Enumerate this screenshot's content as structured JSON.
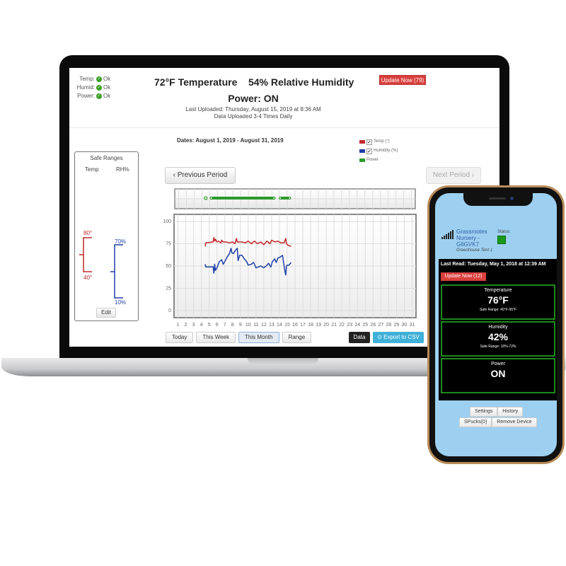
{
  "desktop": {
    "status": [
      {
        "label": "Temp:",
        "value": "Ok"
      },
      {
        "label": "Humid:",
        "value": "Ok"
      },
      {
        "label": "Power:",
        "value": "Ok"
      }
    ],
    "headline": "72°F Temperature    54% Relative Humidity",
    "power": "Power: ON",
    "last_uploaded": "Last Uploaded: Thursday, August 15, 2019 at 8:36 AM",
    "upload_frequency": "Data Uploaded 3-4 Times Daily",
    "update_button": "Update Now (79)",
    "dates": "Dates: August 1, 2019 - August 31, 2019",
    "legend": [
      {
        "label": "Temp (°)",
        "color": "#c0282d",
        "checked": true
      },
      {
        "label": "Humidity (%)",
        "color": "#1f3fa8",
        "checked": true
      },
      {
        "label": "Power",
        "color": "#2d9a2d",
        "checked": null
      }
    ],
    "prev_button": "Previous Period",
    "next_button": "Next Period",
    "safe_ranges": {
      "title": "Safe Ranges",
      "temp_label": "Temp",
      "rh_label": "RH%",
      "temp_high": "80°",
      "temp_low": "40°",
      "rh_high": "70%",
      "rh_low": "10%",
      "edit_button": "Edit"
    },
    "range_buttons": [
      {
        "label": "Today",
        "active": false
      },
      {
        "label": "This Week",
        "active": false
      },
      {
        "label": "This Month",
        "active": true
      },
      {
        "label": "Range",
        "active": false
      }
    ],
    "data_button": "Data",
    "export_button": "Export to CSV"
  },
  "chart_data": {
    "type": "line",
    "title": "",
    "xlabel": "",
    "ylabel": "",
    "x_ticks": [
      "1",
      "2",
      "3",
      "4",
      "5",
      "6",
      "7",
      "8",
      "9",
      "10",
      "11",
      "12",
      "13",
      "14",
      "15",
      "16",
      "17",
      "18",
      "19",
      "20",
      "21",
      "22",
      "23",
      "24",
      "25",
      "26",
      "27",
      "28",
      "29",
      "30",
      "31"
    ],
    "y_ticks": [
      "0",
      "25",
      "50",
      "75",
      "100"
    ],
    "xlim": [
      1,
      31
    ],
    "ylim": [
      -8,
      108
    ],
    "grid": true,
    "series": [
      {
        "name": "Temp (°)",
        "color": "#c0282d",
        "x": [
          4.5,
          4.55,
          5.5,
          5.6,
          5.7,
          5.8,
          6.0,
          6.2,
          6.5,
          6.6,
          6.8,
          7.2,
          7.6,
          8.0,
          8.3,
          8.5,
          8.6,
          8.8,
          9.2,
          9.6,
          10.0,
          10.4,
          10.8,
          11.2,
          11.6,
          12.0,
          12.4,
          12.8,
          13.0,
          13.4,
          13.8,
          14.2,
          14.6,
          14.8,
          14.9,
          15.0,
          15.2,
          15.5
        ],
        "y": [
          72,
          76,
          77,
          82,
          78,
          80,
          77,
          78,
          76,
          79,
          77,
          77,
          76,
          77,
          75,
          81,
          77,
          77,
          77,
          76,
          78,
          75,
          78,
          75,
          77,
          74,
          78,
          75,
          79,
          77,
          78,
          76,
          76,
          81,
          75,
          74,
          73,
          72
        ]
      },
      {
        "name": "Humidity (%)",
        "color": "#1f3fa8",
        "x": [
          4.5,
          4.55,
          5.5,
          5.6,
          5.7,
          5.8,
          6.0,
          6.3,
          6.6,
          6.8,
          7.0,
          7.3,
          7.6,
          7.8,
          7.9,
          8.1,
          8.4,
          8.6,
          8.7,
          8.9,
          9.2,
          9.5,
          9.8,
          10.0,
          10.4,
          10.7,
          11.0,
          11.3,
          11.6,
          12.0,
          12.3,
          12.6,
          12.9,
          13.1,
          13.4,
          13.6,
          13.8,
          14.1,
          14.4,
          14.6,
          14.7,
          14.8,
          14.9,
          15.0,
          15.2,
          15.5
        ],
        "y": [
          52,
          49,
          49,
          42,
          52,
          45,
          48,
          55,
          57,
          52,
          55,
          60,
          64,
          70,
          65,
          64,
          68,
          70,
          56,
          62,
          62,
          58,
          55,
          51,
          52,
          54,
          48,
          49,
          50,
          48,
          50,
          53,
          49,
          55,
          58,
          54,
          59,
          60,
          62,
          50,
          44,
          40,
          50,
          51,
          51,
          54
        ]
      },
      {
        "name": "Power",
        "color": "#2d9a2d",
        "segments": [
          [
            4.5,
            4.5
          ],
          [
            5.2,
            13.3
          ],
          [
            14.1,
            15.3
          ]
        ]
      }
    ]
  },
  "mobile": {
    "device_name": "Grassrootes Nursery - G6GVK7",
    "device_location": "Greenhouse Tent 1",
    "status_label": "Status:",
    "status_color": "#1a9a1a",
    "last_read": "Last Read: Tuesday, May 1, 2018 at 12:39 AM",
    "update_button": "Update Now (12)",
    "cards": [
      {
        "title": "Temperature",
        "value": "76°F",
        "safe": "Safe Range: 40°F-95°F"
      },
      {
        "title": "Humidity",
        "value": "42%",
        "safe": "Safe Range: 10%-72%"
      },
      {
        "title": "Power",
        "value": "ON",
        "safe": ""
      }
    ],
    "buttons_row1": [
      "Settings",
      "History"
    ],
    "buttons_row2": [
      "SPucks(0)",
      "Remove Device"
    ]
  }
}
